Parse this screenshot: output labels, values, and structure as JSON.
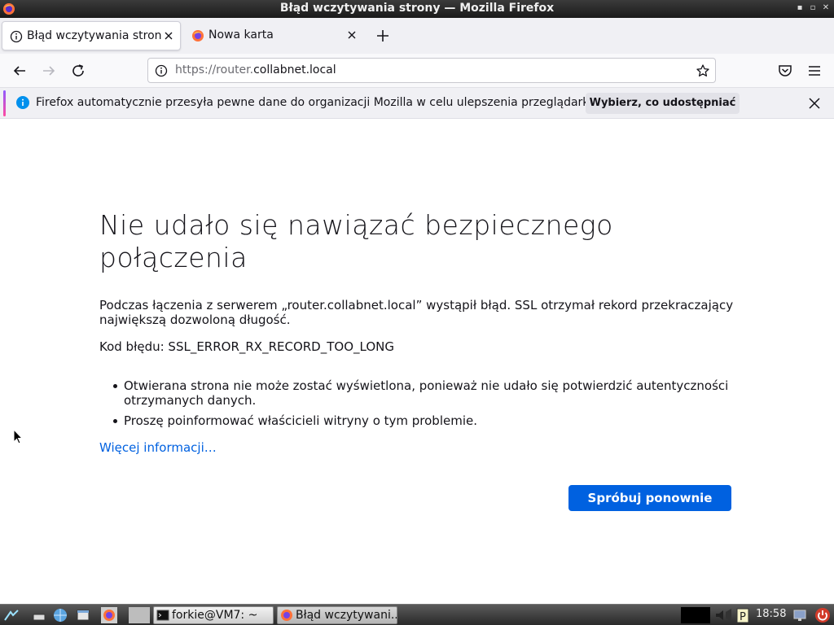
{
  "window": {
    "title": "Błąd wczytywania strony — Mozilla Firefox",
    "controls": [
      "minimize",
      "restore",
      "close"
    ]
  },
  "tabs": [
    {
      "label": "Błąd wczytywania strony",
      "active": true,
      "icon": "info-circle-icon"
    },
    {
      "label": "Nowa karta",
      "active": false,
      "icon": "firefox-icon"
    }
  ],
  "urlbar": {
    "scheme_and_prefix": "https://router.",
    "host": "collabnet.local"
  },
  "notification": {
    "message": "Firefox automatycznie przesyła pewne dane do organizacji Mozilla w celu ulepszenia przeglądarki.",
    "button_label": "Wybierz, co udostępniać"
  },
  "error_page": {
    "title": "Nie udało się nawiązać bezpiecznego połączenia",
    "description": "Podczas łączenia z serwerem „router.collabnet.local” wystąpił błąd. SSL otrzymał rekord przekraczający największą dozwoloną długość.",
    "code_line": "Kod błędu: SSL_ERROR_RX_RECORD_TOO_LONG",
    "bullets": [
      "Otwierana strona nie może zostać wyświetlona, ponieważ nie udało się potwierdzić autentyczności otrzymanych danych.",
      "Proszę poinformować właścicieli witryny o tym problemie."
    ],
    "more_info_link": "Więcej informacji…",
    "retry_button": "Spróbuj ponownie"
  },
  "taskbar": {
    "tasks": [
      {
        "label": "forkie@VM7: ~",
        "icon": "terminal-icon"
      },
      {
        "label": "Błąd wczytywani...",
        "icon": "firefox-icon"
      }
    ],
    "clock": "18:58"
  },
  "colors": {
    "accent_blue": "#0061e0",
    "notification_bg": "#f0f0f4",
    "text": "#15141a"
  }
}
